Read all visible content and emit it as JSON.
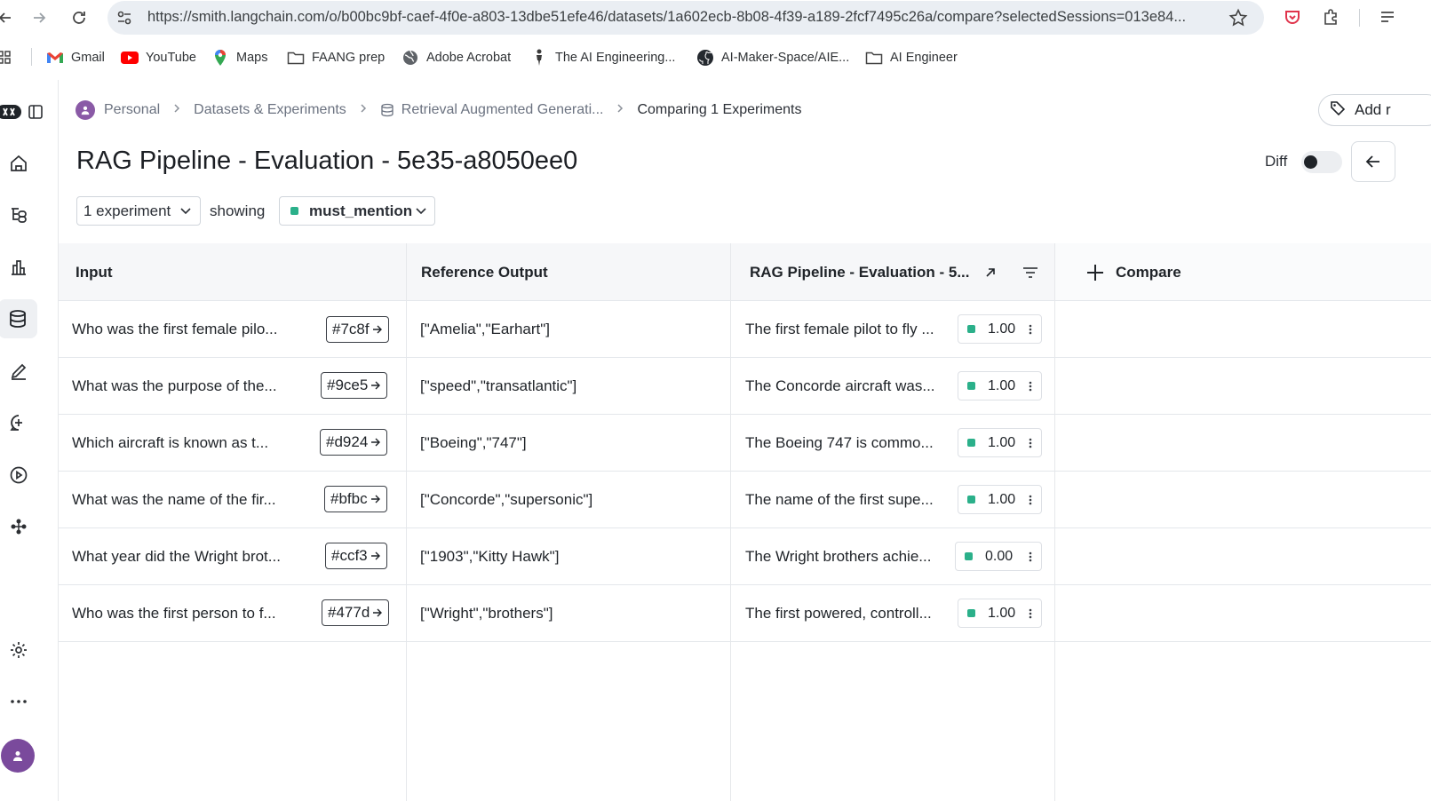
{
  "browser": {
    "url": "https://smith.langchain.com/o/b00bc9bf-caef-4f0e-a803-13dbe51efe46/datasets/1a602ecb-8b08-4f39-a189-2fcf7495c26a/compare?selectedSessions=013e84...",
    "bookmarks": [
      {
        "label": "Gmail",
        "icon": "gmail-icon"
      },
      {
        "label": "YouTube",
        "icon": "youtube-icon"
      },
      {
        "label": "Maps",
        "icon": "maps-pin-icon"
      },
      {
        "label": "FAANG prep",
        "icon": "folder-icon"
      },
      {
        "label": "Adobe Acrobat",
        "icon": "globe-icon"
      },
      {
        "label": "The AI Engineering...",
        "icon": "person-figure-icon"
      },
      {
        "label": "AI-Maker-Space/AIE...",
        "icon": "github-icon"
      },
      {
        "label": "AI Engineer",
        "icon": "folder-icon"
      }
    ]
  },
  "breadcrumb": {
    "items": [
      "Personal",
      "Datasets & Experiments",
      "Retrieval Augmented Generati...",
      "Comparing 1 Experiments"
    ]
  },
  "header": {
    "title": "RAG Pipeline - Evaluation - 5e35-a8050ee0",
    "add_button": "Add r",
    "diff_label": "Diff",
    "diff_on": false
  },
  "filters": {
    "experiments": "1 experiment",
    "showing": "showing",
    "metric": "must_mention",
    "metric_color": "#2bb08a"
  },
  "table": {
    "columns": [
      "Input",
      "Reference Output",
      "RAG Pipeline - Evaluation - 5...",
      "Compare"
    ],
    "rows": [
      {
        "input": "Who was the first female pilo...",
        "hash": "#7c8f",
        "reference": "[\"Amelia\",\"Earhart\"]",
        "output": "The first female pilot to fly ...",
        "score": "1.00"
      },
      {
        "input": "What was the purpose of the...",
        "hash": "#9ce5",
        "reference": "[\"speed\",\"transatlantic\"]",
        "output": "The Concorde aircraft was...",
        "score": "1.00"
      },
      {
        "input": "Which aircraft is known as t...",
        "hash": "#d924",
        "reference": "[\"Boeing\",\"747\"]",
        "output": "The Boeing 747 is commo...",
        "score": "1.00"
      },
      {
        "input": "What was the name of the fir...",
        "hash": "#bfbc",
        "reference": "[\"Concorde\",\"supersonic\"]",
        "output": "The name of the first supe...",
        "score": "1.00"
      },
      {
        "input": "What year did the Wright brot...",
        "hash": "#ccf3",
        "reference": "[\"1903\",\"Kitty Hawk\"]",
        "output": "The Wright brothers achie...",
        "score": "0.00"
      },
      {
        "input": "Who was the first person to f...",
        "hash": "#477d",
        "reference": "[\"Wright\",\"brothers\"]",
        "output": "The first powered, controll...",
        "score": "1.00"
      }
    ]
  }
}
